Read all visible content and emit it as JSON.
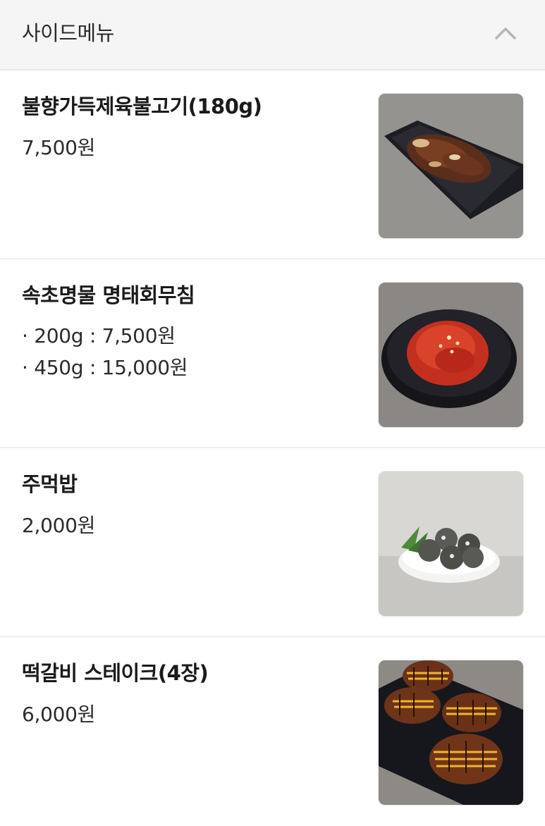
{
  "header": {
    "title": "사이드메뉴",
    "collapse_icon": "chevron-up-icon"
  },
  "menu": {
    "items": [
      {
        "name": "불향가득제육불고기(180g)",
        "price": "7,500원",
        "image_icon": "pork-bulgogi-photo"
      },
      {
        "name": "속초명물 명태회무침",
        "options": [
          "· 200g : 7,500원",
          "· 450g : 15,000원"
        ],
        "image_icon": "pollack-salad-photo"
      },
      {
        "name": "주먹밥",
        "price": "2,000원",
        "image_icon": "rice-ball-photo"
      },
      {
        "name": "떡갈비 스테이크(4장)",
        "price": "6,000원",
        "image_icon": "tteokgalbi-steak-photo"
      }
    ]
  },
  "colors": {
    "header_bg": "#f5f5f5",
    "divider": "#f0f0f0",
    "text_primary": "#1a1a1a"
  }
}
